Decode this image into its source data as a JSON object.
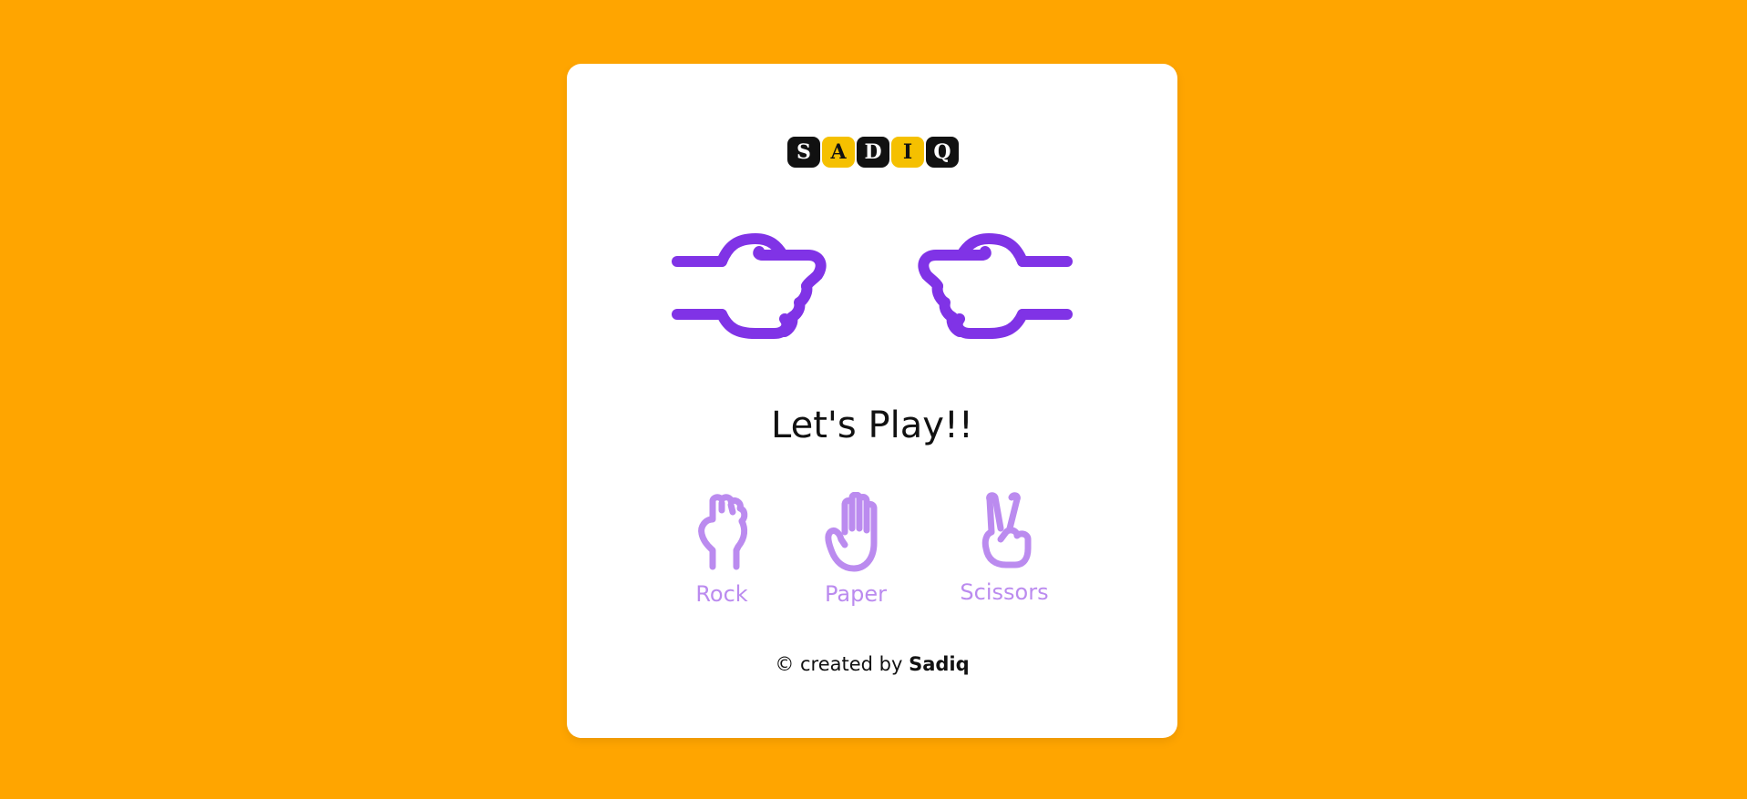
{
  "logo": {
    "letters": [
      "S",
      "A",
      "D",
      "I",
      "Q"
    ]
  },
  "title": "Let's Play!!",
  "choices": [
    {
      "label": "Rock",
      "icon": "rock-hand-icon"
    },
    {
      "label": "Paper",
      "icon": "paper-hand-icon"
    },
    {
      "label": "Scissors",
      "icon": "scissors-hand-icon"
    }
  ],
  "footer": {
    "prefix": "© created by",
    "author": "Sadiq"
  },
  "colors": {
    "background": "#FFA500",
    "card": "#FFFFFF",
    "hand_primary": "#8033E6",
    "choice_color": "#BB8BEF",
    "logo_dark": "#111111",
    "logo_gold": "#F5C000"
  }
}
